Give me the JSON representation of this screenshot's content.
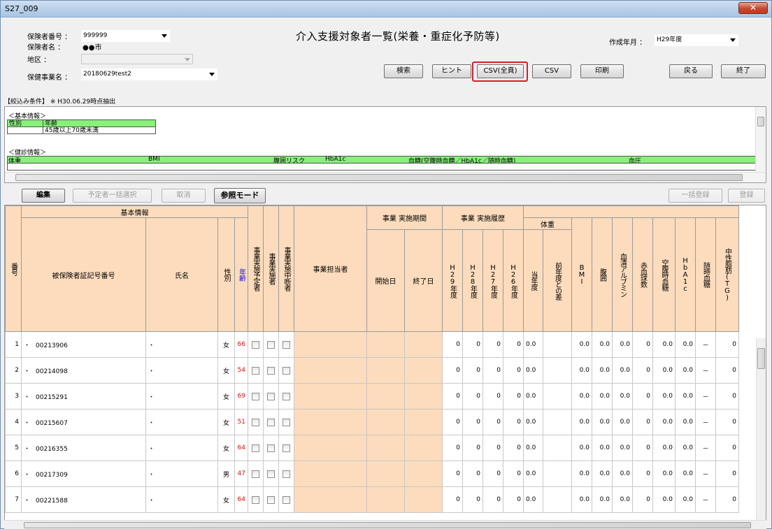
{
  "window": {
    "title": "S27_009"
  },
  "header": {
    "insurer_no_label": "保険者番号 ：",
    "insurer_no_value": "999999",
    "insurer_name_label": "保険者名 ：",
    "insurer_name_value": "●●市",
    "area_label": "地区 ：",
    "project_label": "保健事業名 ：",
    "project_value": "20180629test2",
    "page_title": "介入支援対象者一覧(栄養・重症化予防等)",
    "created_label": "作成年月 ：",
    "created_value": "H29年度"
  },
  "toolbar": {
    "search": "検索",
    "hint": "ヒント",
    "csv_all": "CSV(全頁)",
    "csv": "CSV",
    "print": "印刷",
    "back": "戻る",
    "exit": "終了"
  },
  "filter": {
    "conditions": "【絞込み条件】 ※ H30.06.29時点抽出",
    "basic_header": "＜基本情報＞",
    "sex_col": "性別",
    "age_col": "年齢",
    "age_val": "45歳以上70歳未満",
    "checkup_header": "＜健診情報＞",
    "checkup_cols": [
      "体重",
      "BMI",
      "腹囲リスク",
      "HbA1c",
      "血糖(空腹時血糖／HbA1c／随時血糖)",
      "血圧"
    ]
  },
  "actions": {
    "edit": "編集",
    "select_all": "予定者一括選択",
    "cancel": "取消",
    "ref_mode": "参照モード",
    "register_all": "一括登録",
    "register": "登録"
  },
  "grid": {
    "headers": {
      "basic": "基本情報",
      "period": "事業 実施期間",
      "history": "事業 実施履歴",
      "weight": "体重",
      "no": "番号",
      "insured_no": "被保険者証記号番号",
      "name": "氏名",
      "sex": "性別",
      "age": "年齢",
      "plan": "事業実施予定者",
      "done": "事業実施者",
      "stop": "事業実施中断者",
      "staff": "事業担当者",
      "start": "開始日",
      "end": "終了日",
      "h29": "H29年度",
      "h28": "H28年度",
      "h27": "H27年度",
      "h26": "H26年度",
      "cur": "当年度",
      "diff": "前年度との差",
      "bmi": "BMI",
      "waist": "腹囲",
      "alb": "血清アルブミン",
      "rbc": "赤血球数",
      "fbs": "空腹時血糖",
      "hba1c": "HbA1c",
      "rbs": "随時血糖",
      "tg": "中性脂肪(TG)"
    },
    "rows": [
      {
        "no": "1",
        "dot": "・",
        "id": "00213906",
        "name": "・",
        "sex": "女",
        "age": "66",
        "h29": "0",
        "h28": "0",
        "h27": "0",
        "h26": "0",
        "cur": "0.0",
        "bmi": "0.0",
        "waist": "0.0",
        "alb": "0.0",
        "rbc": "0",
        "fbs": "0.0",
        "hba1c": "0.0",
        "rbs": "－",
        "tg": "0"
      },
      {
        "no": "2",
        "dot": "・",
        "id": "00214098",
        "name": "・",
        "sex": "女",
        "age": "54",
        "h29": "0",
        "h28": "0",
        "h27": "0",
        "h26": "0",
        "cur": "0.0",
        "bmi": "0.0",
        "waist": "0.0",
        "alb": "0.0",
        "rbc": "0",
        "fbs": "0.0",
        "hba1c": "0.0",
        "rbs": "－",
        "tg": "0"
      },
      {
        "no": "3",
        "dot": "・",
        "id": "00215291",
        "name": "・",
        "sex": "女",
        "age": "69",
        "h29": "0",
        "h28": "0",
        "h27": "0",
        "h26": "0",
        "cur": "0.0",
        "bmi": "0.0",
        "waist": "0.0",
        "alb": "0.0",
        "rbc": "0",
        "fbs": "0.0",
        "hba1c": "0.0",
        "rbs": "－",
        "tg": "0"
      },
      {
        "no": "4",
        "dot": "・",
        "id": "00215607",
        "name": "・",
        "sex": "女",
        "age": "51",
        "h29": "0",
        "h28": "0",
        "h27": "0",
        "h26": "0",
        "cur": "0.0",
        "bmi": "0.0",
        "waist": "0.0",
        "alb": "0.0",
        "rbc": "0",
        "fbs": "0.0",
        "hba1c": "0.0",
        "rbs": "－",
        "tg": "0"
      },
      {
        "no": "5",
        "dot": "・",
        "id": "00216355",
        "name": "・",
        "sex": "女",
        "age": "64",
        "h29": "0",
        "h28": "0",
        "h27": "0",
        "h26": "0",
        "cur": "0.0",
        "bmi": "0.0",
        "waist": "0.0",
        "alb": "0.0",
        "rbc": "0",
        "fbs": "0.0",
        "hba1c": "0.0",
        "rbs": "－",
        "tg": "0"
      },
      {
        "no": "6",
        "dot": "・",
        "id": "00217309",
        "name": "・",
        "sex": "男",
        "age": "47",
        "h29": "0",
        "h28": "0",
        "h27": "0",
        "h26": "0",
        "cur": "0.0",
        "bmi": "0.0",
        "waist": "0.0",
        "alb": "0.0",
        "rbc": "0",
        "fbs": "0.0",
        "hba1c": "0.0",
        "rbs": "－",
        "tg": "0"
      },
      {
        "no": "7",
        "dot": "・",
        "id": "00221588",
        "name": "・",
        "sex": "女",
        "age": "64",
        "h29": "0",
        "h28": "0",
        "h27": "0",
        "h26": "0",
        "cur": "0.0",
        "bmi": "0.0",
        "waist": "0.0",
        "alb": "0.0",
        "rbc": "0",
        "fbs": "0.0",
        "hba1c": "0.0",
        "rbs": "－",
        "tg": "0"
      }
    ]
  },
  "colors": {
    "header_bg": "#fcdcbc",
    "filter_green": "#88f07b",
    "highlight": "#d81e2a",
    "age_red": "#e01010"
  }
}
